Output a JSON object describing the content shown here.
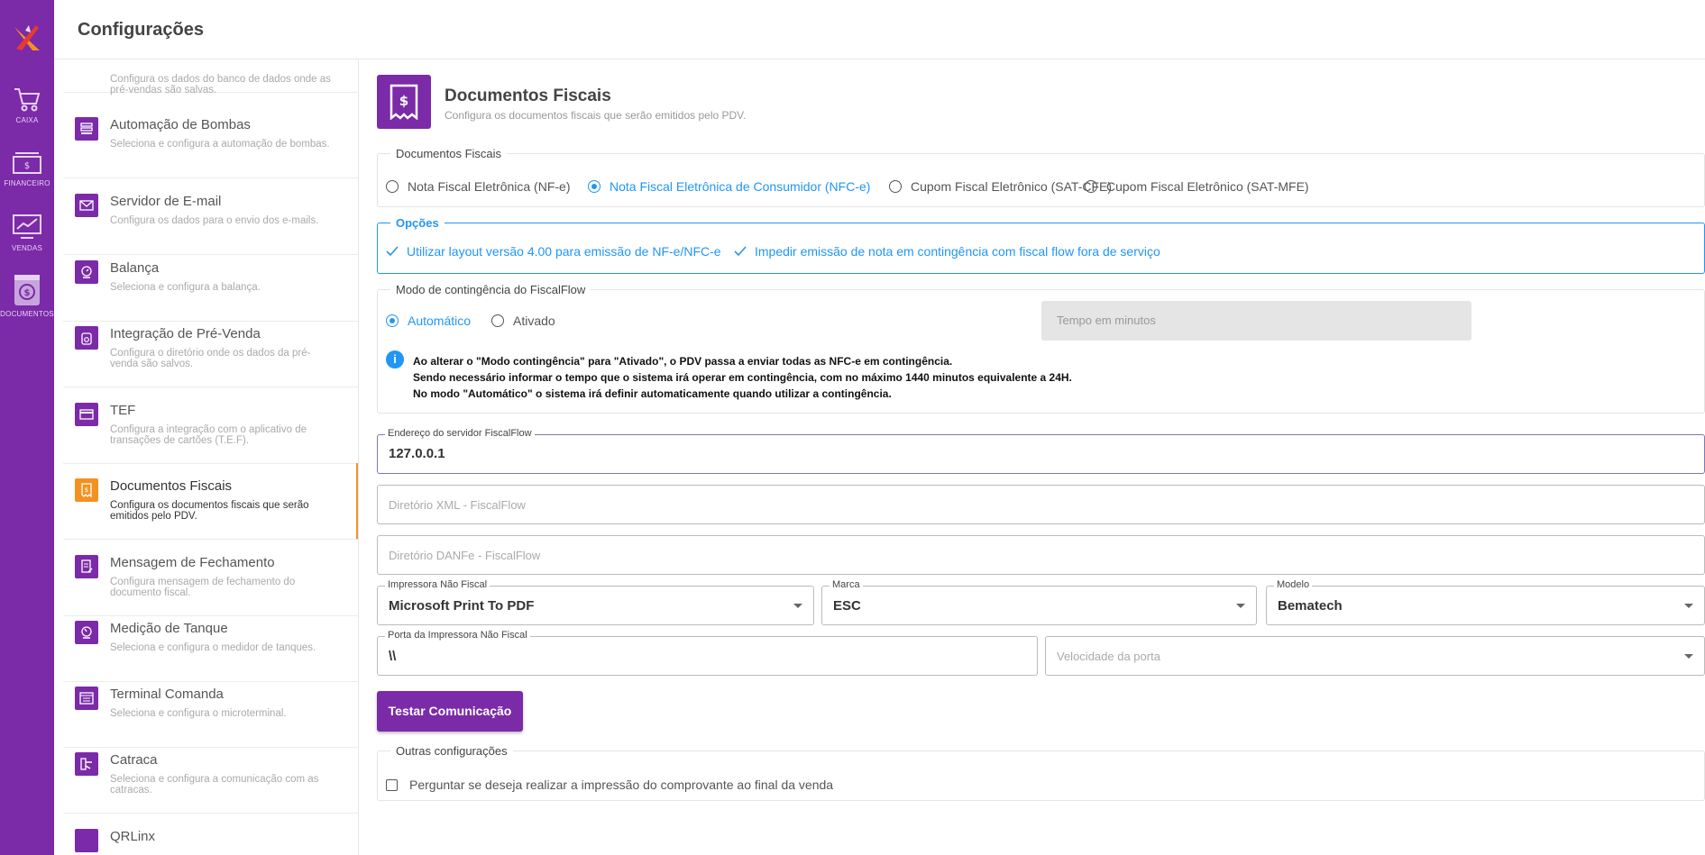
{
  "app": {
    "title": "Configurações"
  },
  "rail": {
    "items": [
      {
        "label": "CAIXA",
        "icon": "cart-icon"
      },
      {
        "label": "FINANCEIRO",
        "icon": "money-icon"
      },
      {
        "label": "VENDAS",
        "icon": "chart-icon"
      },
      {
        "label": "DOCUMENTOS",
        "icon": "document-icon"
      }
    ]
  },
  "menu": {
    "partial_top_desc": "Configura os dados do banco de dados onde as pré-vendas são salvas.",
    "items": [
      {
        "title": "Automação de Bombas",
        "desc": "Seleciona e configura a automação de bombas."
      },
      {
        "title": "Servidor de E-mail",
        "desc": "Configura os dados para o envio dos e-mails."
      },
      {
        "title": "Balança",
        "desc": "Seleciona e configura a balança."
      },
      {
        "title": "Integração de Pré-Venda",
        "desc": "Configura o diretório onde os dados da pré-venda são salvos."
      },
      {
        "title": "TEF",
        "desc": "Configura a integração com o aplicativo de transações de cartões (T.E.F)."
      },
      {
        "title": "Documentos Fiscais",
        "desc": "Configura os documentos fiscais que serão emitidos pelo PDV."
      },
      {
        "title": "Mensagem de Fechamento",
        "desc": "Configura mensagem de fechamento do documento fiscal."
      },
      {
        "title": "Medição de Tanque",
        "desc": "Seleciona e configura o medidor de tanques."
      },
      {
        "title": "Terminal Comanda",
        "desc": "Seleciona e configura o microterminal."
      },
      {
        "title": "Catraca",
        "desc": "Seleciona e configura a comunicação com as catracas."
      },
      {
        "title": "QRLinx",
        "desc": ""
      }
    ]
  },
  "page": {
    "title": "Documentos Fiscais",
    "subtitle": "Configura os documentos fiscais que serão emitidos pelo PDV."
  },
  "docs": {
    "legend": "Documentos Fiscais",
    "options": [
      "Nota Fiscal Eletrônica (NF-e)",
      "Nota Fiscal Eletrônica de Consumidor (NFC-e)",
      "Cupom Fiscal Eletrônico (SAT-CFE)",
      "Cupom Fiscal Eletrônico (SAT-MFE)"
    ],
    "selected": "Nota Fiscal Eletrônica de Consumidor (NFC-e)"
  },
  "opcoes": {
    "legend": "Opções",
    "items": [
      "Utilizar layout versão 4.00 para emissão de NF-e/NFC-e",
      "Impedir emissão de nota em contingência com fiscal flow fora de serviço"
    ]
  },
  "contingencia": {
    "legend": "Modo de contingência do FiscalFlow",
    "options": [
      "Automático",
      "Ativado"
    ],
    "selected": "Automático",
    "tempo_placeholder": "Tempo em minutos",
    "info": [
      "Ao alterar o \"Modo contingência\" para \"Ativado\", o PDV passa a enviar todas as NFC-e em contingência.",
      "Sendo necessário informar o tempo que o sistema irá operar em contingência, com no máximo 1440 minutos equivalente a 24H.",
      "No modo \"Automático\" o sistema irá definir automaticamente quando utilizar a contingência."
    ]
  },
  "fields": {
    "endereco_label": "Endereço do servidor FiscalFlow",
    "endereco_value": "127.0.0.1",
    "xml_placeholder": "Diretório XML - FiscalFlow",
    "danfe_placeholder": "Diretório DANFe - FiscalFlow",
    "impressora_label": "Impressora Não Fiscal",
    "impressora_value": "Microsoft Print To PDF",
    "marca_label": "Marca",
    "marca_value": "ESC",
    "modelo_label": "Modelo",
    "modelo_value": "Bematech",
    "porta_label": "Porta da Impressora Não Fiscal",
    "porta_value": "\\\\",
    "velocidade_placeholder": "Velocidade da porta"
  },
  "button": {
    "testar": "Testar Comunicação"
  },
  "outras": {
    "legend": "Outras configurações",
    "checkbox": "Perguntar se deseja realizar a impressão do comprovante ao final da venda"
  },
  "colors": {
    "brand": "#7b2aa8",
    "accent": "#2196f3",
    "active": "#f39221"
  }
}
